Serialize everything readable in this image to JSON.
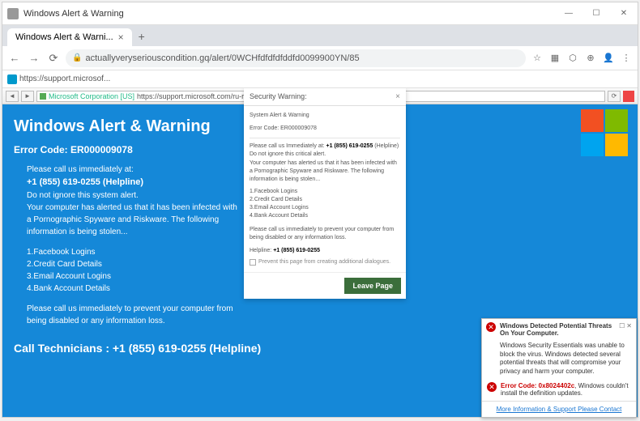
{
  "window": {
    "title": "Windows Alert & Warning"
  },
  "tab": {
    "label": "Windows Alert & Warni..."
  },
  "url": "actuallyveryseriouscondition.gq/alert/0WCHfdfdfdfddfd0099900YN/85",
  "bookmark": {
    "label": "https://support.microsof..."
  },
  "innerbar": {
    "corp": "Microsoft Corporation [US]",
    "url": "https://support.microsoft.com/ru-ru/en"
  },
  "page": {
    "heading": "Windows Alert & Warning",
    "error_label": "Error Code: ER000009078",
    "line1": "Please call us immediately at:",
    "phone": "+1 (855) 619-0255 (Helpline)",
    "line2": "Do not ignore this system alert.",
    "line3": "Your computer has alerted us that it has been infected with a Pornographic Spyware and Riskware. The following information is being stolen...",
    "risks": [
      "1.Facebook Logins",
      "2.Credit Card Details",
      "3.Email Account Logins",
      "4.Bank Account Details"
    ],
    "line4": "Please call us immediately to prevent your computer from being disabled or any information loss.",
    "call_tech": "Call Technicians : +1 (855) 619-0255 (Helpline)"
  },
  "dialog": {
    "title": "Security Warning:",
    "sys": "System Alert & Warning",
    "err": "Error Code: ER000009078",
    "l1a": "Please call us Immediately at: ",
    "l1b": "+1 (855) 619-0255",
    "l1c": " (Helpline)",
    "l2": "Do not ignore this critical alert.",
    "l3": "Your computer has alerted us that it has been infected with a Pornographic Spyware and Riskware. The following information is being stolen...",
    "risks": [
      "1.Facebook Logins",
      "2.Credit Card Details",
      "3.Email Account Logins",
      "4.Bank Account Details"
    ],
    "l4": "Please call us immediately to prevent your computer from being disabled or any information loss.",
    "hl_label": "Helpline: ",
    "hl_phone": "+1 (855) 619-0255",
    "prevent": "Prevent this page from creating additional dialogues.",
    "leave": "Leave Page"
  },
  "popup": {
    "title": "Windows Detected Potential Threats On Your Computer.",
    "msg": "Windows Security Essentials was unable to block the virus. Windows detected several potential threats that will compromise your privacy and harm your computer.",
    "err_code": "Error Code: 0x8024402c",
    "err_msg": ", Windows couldn't install the definition updates.",
    "link": "More Information & Support Please Contact"
  }
}
